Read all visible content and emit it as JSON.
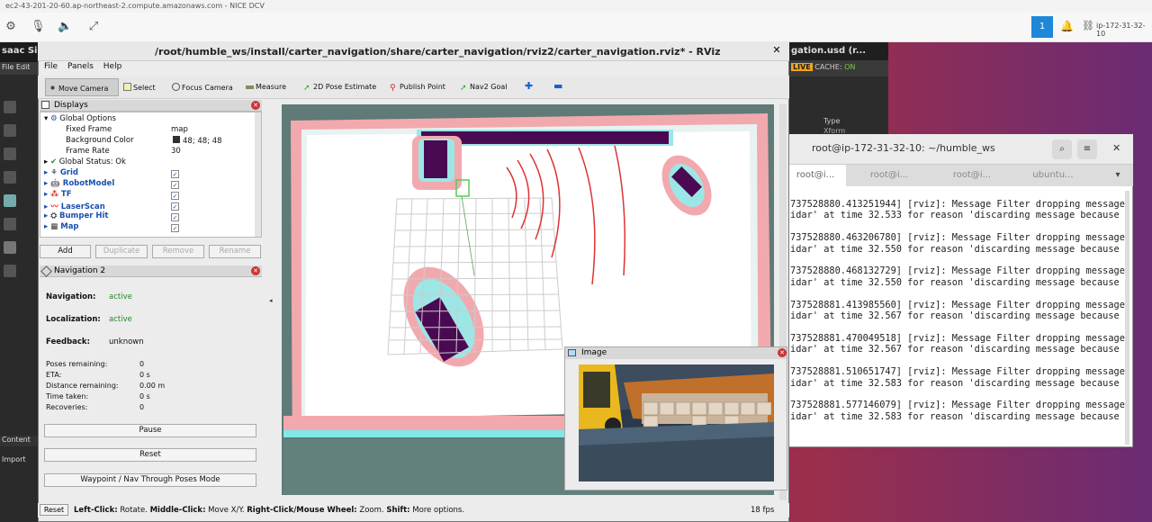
{
  "dcv": {
    "url_title": "ec2-43-201-20-60.ap-northeast-2.compute.amazonaws.com - NICE DCV",
    "badge_count": "1",
    "host": "ip-172-31-32-10"
  },
  "isaac": {
    "title": "saac Si",
    "menu": "File  Edit",
    "right_title": "gation.usd (r...",
    "live": "LIVE",
    "cache_label": "CACHE:",
    "cache_value": "ON",
    "stage_col": "Type",
    "stage_row": "Xform",
    "content_label": "Content",
    "import_label": "Import"
  },
  "rviz": {
    "title": "/root/humble_ws/install/carter_navigation/share/carter_navigation/rviz2/carter_navigation.rviz* - RViz",
    "menu": [
      "File",
      "Panels",
      "Help"
    ],
    "tools": [
      "Move Camera",
      "Select",
      "Focus Camera",
      "Measure",
      "2D Pose Estimate",
      "Publish Point",
      "Nav2 Goal"
    ],
    "displays": {
      "header": "Displays",
      "global_options": "Global Options",
      "fixed_frame_label": "Fixed Frame",
      "fixed_frame_value": "map",
      "bg_label": "Background Color",
      "bg_value": "48; 48; 48",
      "frame_rate_label": "Frame Rate",
      "frame_rate_value": "30",
      "global_status": "Global Status: Ok",
      "items": [
        "Grid",
        "RobotModel",
        "TF",
        "LaserScan",
        "Bumper Hit",
        "Map"
      ],
      "buttons": [
        "Add",
        "Duplicate",
        "Remove",
        "Rename"
      ]
    },
    "nav2": {
      "header": "Navigation 2",
      "navigation_label": "Navigation:",
      "navigation_value": "active",
      "localization_label": "Localization:",
      "localization_value": "active",
      "feedback_label": "Feedback:",
      "feedback_value": "unknown",
      "poses_label": "Poses remaining:",
      "poses_value": "0",
      "eta_label": "ETA:",
      "eta_value": "0 s",
      "distance_label": "Distance remaining:",
      "distance_value": "0.00 m",
      "time_label": "Time taken:",
      "time_value": "0 s",
      "recoveries_label": "Recoveries:",
      "recoveries_value": "0",
      "pause": "Pause",
      "reset": "Reset",
      "waypoint": "Waypoint / Nav Through Poses Mode"
    },
    "image_panel": {
      "header": "Image"
    },
    "status": {
      "reset": "Reset",
      "left_click": "Left-Click:",
      "left_text": " Rotate. ",
      "middle_click": "Middle-Click:",
      "middle_text": " Move X/Y. ",
      "right_click": "Right-Click/Mouse Wheel:",
      "right_text": " Zoom. ",
      "shift": "Shift:",
      "shift_text": " More options.",
      "fps": "18 fps"
    }
  },
  "terminal": {
    "title": "root@ip-172-31-32-10: ~/humble_ws",
    "tabs": [
      "root@i...",
      "root@i...",
      "root@i...",
      "ubuntu..."
    ],
    "lines": [
      "737528880.413251944] [rviz]: Message Filter dropping message",
      "idar' at time 32.533 for reason 'discarding message because",
      "",
      "737528880.463206780] [rviz]: Message Filter dropping message",
      "idar' at time 32.550 for reason 'discarding message because",
      "",
      "737528880.468132729] [rviz]: Message Filter dropping message",
      "idar' at time 32.550 for reason 'discarding message because",
      "",
      "737528881.413985560] [rviz]: Message Filter dropping message",
      "idar' at time 32.567 for reason 'discarding message because",
      "",
      "737528881.470049518] [rviz]: Message Filter dropping message",
      "idar' at time 32.567 for reason 'discarding message because",
      "",
      "737528881.510651747] [rviz]: Message Filter dropping message",
      "idar' at time 32.583 for reason 'discarding message because",
      "",
      "737528881.577146079] [rviz]: Message Filter dropping message",
      "idar' at time 32.583 for reason 'discarding message because"
    ]
  }
}
